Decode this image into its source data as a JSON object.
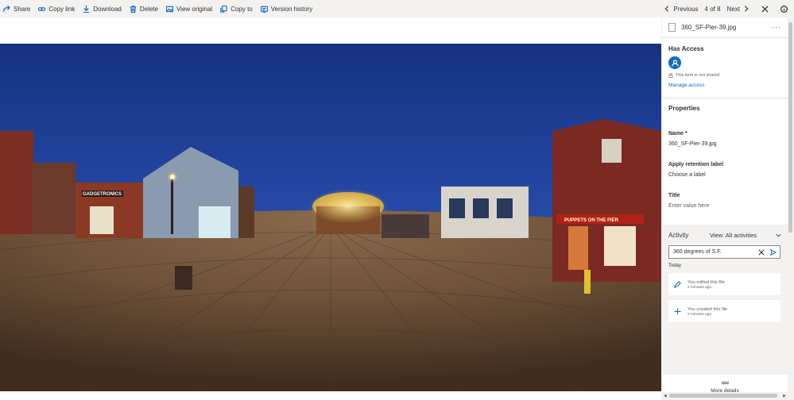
{
  "toolbar": {
    "share": "Share",
    "copy_link": "Copy link",
    "download": "Download",
    "delete": "Delete",
    "view_original": "View original",
    "copy_to": "Copy to",
    "version_history": "Version history",
    "previous": "Previous",
    "counter": "4 of 8",
    "next": "Next"
  },
  "details": {
    "file_name": "360_SF-Pier-39.jpg",
    "has_access_title": "Has Access",
    "not_shared": "This item is not shared",
    "manage_access": "Manage access",
    "properties_title": "Properties",
    "fields": [
      {
        "label": "Name *",
        "value": "360_SF-Pier-39.jpg"
      },
      {
        "label": "Apply retention label",
        "value": "Choose a label"
      },
      {
        "label": "Title",
        "value": "Enter value here"
      }
    ],
    "activity_title": "Activity",
    "activity_filter": "View: All activities",
    "activity_search": "360 degrees of S.F.",
    "today": "Today",
    "items": [
      {
        "text": "You edited this file",
        "time": "2 minutes ago",
        "icon": "pencil-icon"
      },
      {
        "text": "You created this file",
        "time": "2 minutes ago",
        "icon": "plus-icon"
      }
    ],
    "more_details": "More details"
  },
  "photo_signs": {
    "left_sign": "GADGETRONICS",
    "right_sign": "PUPPETS ON THE PIER"
  },
  "colors": {
    "accent": "#0f6cbd",
    "sky": "#1e3f9c",
    "boardwalk": "#6e5138"
  }
}
